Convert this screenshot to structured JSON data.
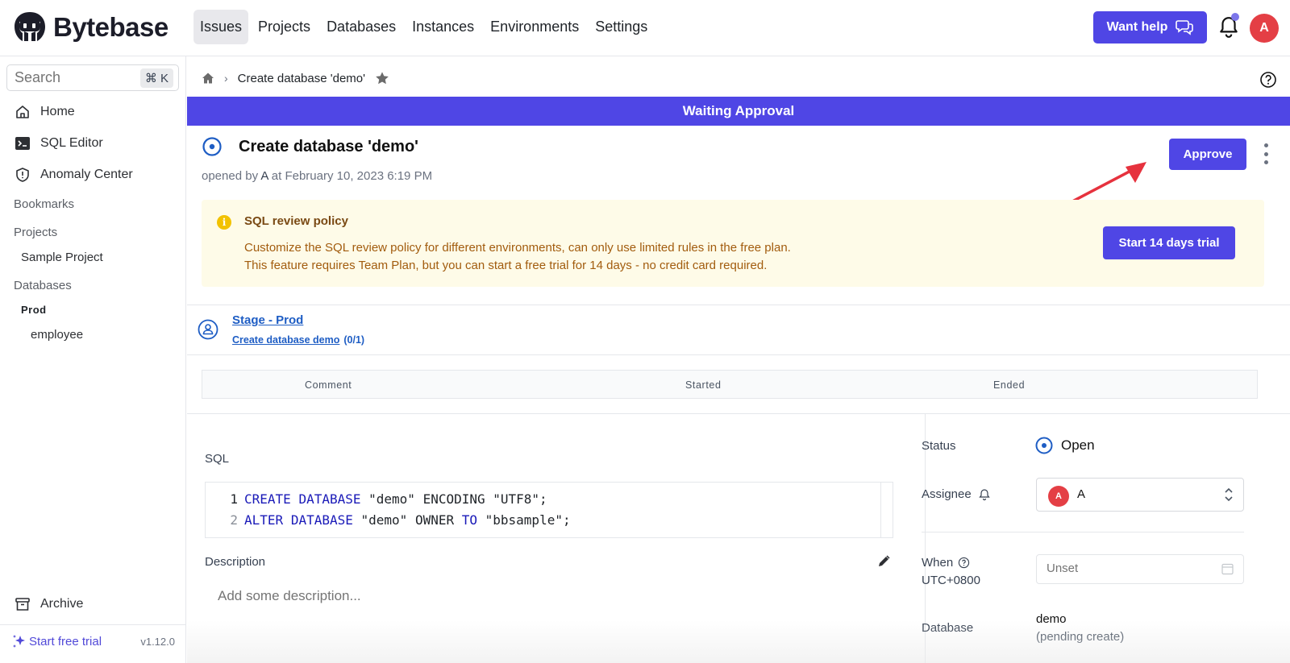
{
  "app": {
    "brand": "Bytebase",
    "colors": {
      "accent": "#4f46e5",
      "danger": "#e43f45",
      "link": "#1e5dc4",
      "warning_bg": "#fefbe8"
    }
  },
  "topnav": {
    "items": [
      {
        "label": "Issues",
        "active": true
      },
      {
        "label": "Projects",
        "active": false
      },
      {
        "label": "Databases",
        "active": false
      },
      {
        "label": "Instances",
        "active": false
      },
      {
        "label": "Environments",
        "active": false
      },
      {
        "label": "Settings",
        "active": false
      }
    ],
    "want_help": "Want help",
    "avatar_initial": "A"
  },
  "sidebar": {
    "search_placeholder": "Search",
    "search_shortcut": "⌘ K",
    "items": [
      {
        "label": "Home",
        "icon": "home-icon"
      },
      {
        "label": "SQL Editor",
        "icon": "terminal-icon"
      },
      {
        "label": "Anomaly Center",
        "icon": "shield-icon"
      }
    ],
    "bookmarks_label": "Bookmarks",
    "projects_label": "Projects",
    "projects": [
      "Sample Project"
    ],
    "databases_label": "Databases",
    "environment": "Prod",
    "databases": [
      "employee"
    ],
    "archive": "Archive",
    "start_free_trial": "Start free trial",
    "version": "v1.12.0"
  },
  "breadcrumb": {
    "current": "Create database 'demo'"
  },
  "issue": {
    "banner": "Waiting Approval",
    "title": "Create database 'demo'",
    "opened_prefix": "opened by",
    "opened_by": "A",
    "opened_at": "at February 10, 2023 6:19 PM",
    "approve_label": "Approve"
  },
  "policy": {
    "title": "SQL review policy",
    "line1": "Customize the SQL review policy for different environments, can only use limited rules in the free plan.",
    "line2": "This feature requires Team Plan, but you can start a free trial for 14 days - no credit card required.",
    "trial_button": "Start 14 days trial"
  },
  "stage": {
    "name": "Stage - Prod",
    "task": "Create database demo",
    "progress": "(0/1)"
  },
  "task_table": {
    "columns": [
      "Comment",
      "Started",
      "Ended"
    ]
  },
  "sql": {
    "label": "SQL",
    "lines": [
      {
        "num": "1",
        "tokens": [
          {
            "t": "CREATE",
            "kw": true
          },
          {
            "t": " "
          },
          {
            "t": "DATABASE",
            "kw": true
          },
          {
            "t": " \"demo\" ENCODING \"UTF8\";"
          }
        ]
      },
      {
        "num": "2",
        "tokens": [
          {
            "t": "ALTER",
            "kw": true
          },
          {
            "t": " "
          },
          {
            "t": "DATABASE",
            "kw": true
          },
          {
            "t": " \"demo\" OWNER "
          },
          {
            "t": "TO",
            "kw": true
          },
          {
            "t": " \"bbsample\";"
          }
        ]
      }
    ]
  },
  "description": {
    "label": "Description",
    "placeholder": "Add some description..."
  },
  "details": {
    "status_label": "Status",
    "status_value": "Open",
    "assignee_label": "Assignee",
    "assignee_initial": "A",
    "assignee_name": "A",
    "when_label": "When",
    "timezone": "UTC+0800",
    "when_placeholder": "Unset",
    "database_label": "Database",
    "database_name": "demo",
    "database_state": "(pending create)"
  }
}
